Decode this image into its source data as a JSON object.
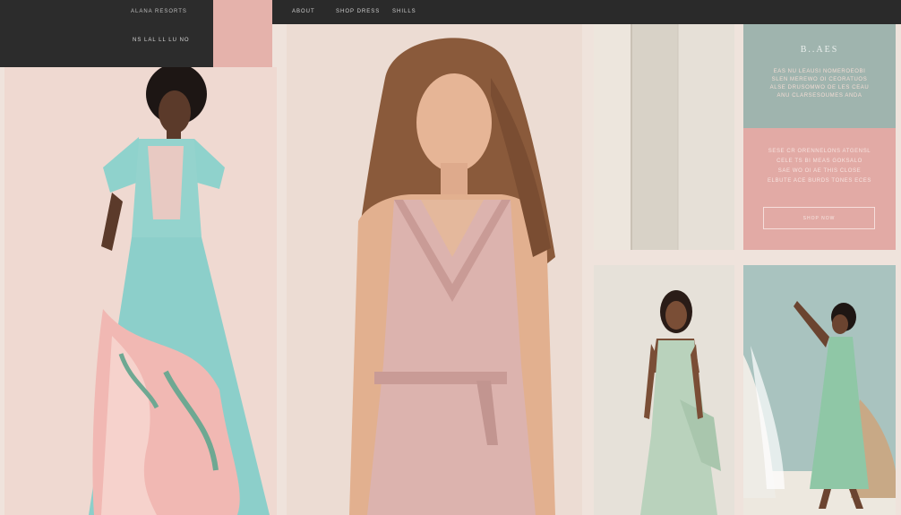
{
  "header": {
    "brand": "ALANA  RESORTS",
    "tagline": "NS LAL LL LU NO"
  },
  "nav": {
    "items": [
      {
        "label": "ABOUT"
      },
      {
        "label": "SHOP DRESS"
      },
      {
        "label": "SHILLS"
      }
    ]
  },
  "sidebar": {
    "heading": "B..AES",
    "top_lines": [
      "EAS NU LEAUSI NOMEROEOBI",
      "SLEN MEREWO OI CEORATUOS",
      "ALSE DRUSOMWO OE LES CEAU",
      "ANU CLARSESOUMES ANDA"
    ],
    "bottom_lines": [
      "SESE CR ORENNELONS ATGENSL",
      "CELE TS BI MEAS GOKSALO",
      "SAE WO OI AE THIS CLOSE",
      "ELBUTE ACE BURDS TONES ECES"
    ],
    "cta_label": "SHOP NOW"
  },
  "colors": {
    "dark_bar": "#2c2c2c",
    "blush": "#e5b2ab",
    "sage": "#9fb4ae",
    "rose": "#e2aaa5",
    "cream": "#efe3dc"
  }
}
